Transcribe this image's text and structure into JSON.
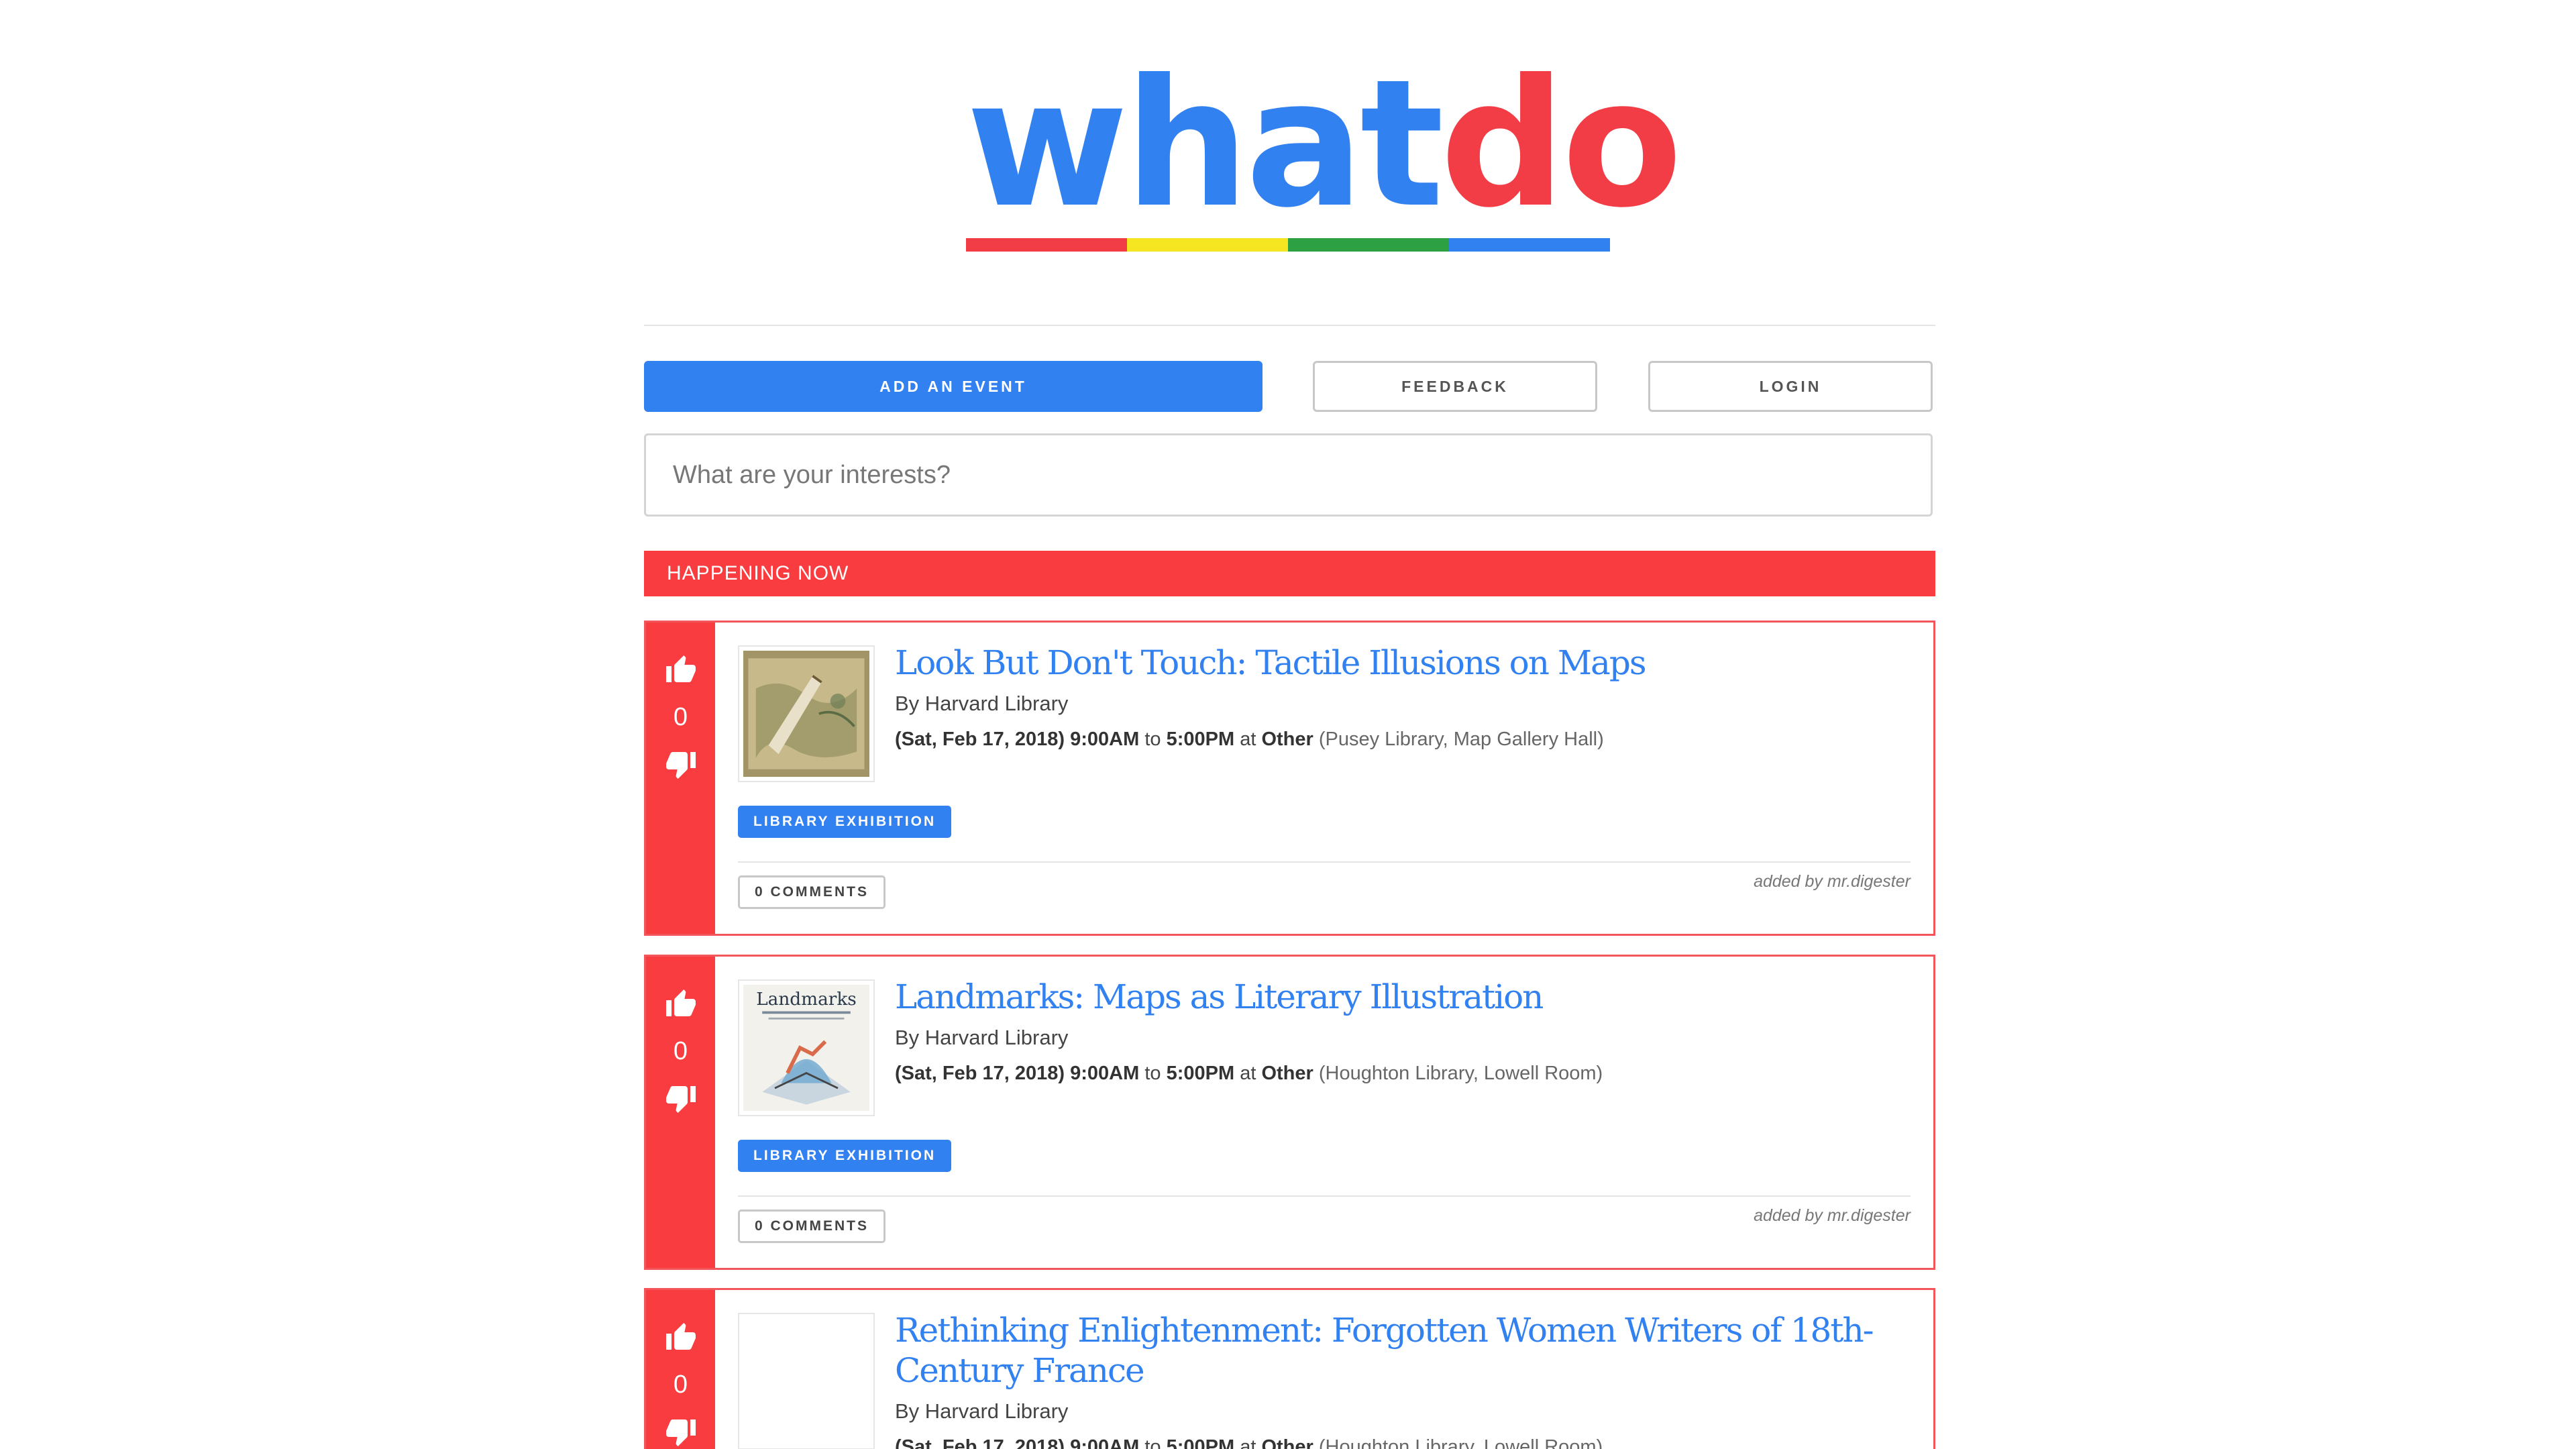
{
  "logo": {
    "part1": "what",
    "part2": "do",
    "bar_colors": [
      "#f23d46",
      "#f6e521",
      "#2da043",
      "#3281f0"
    ]
  },
  "colors": {
    "primary": "#3281f0",
    "accent_red": "#f83c3f"
  },
  "buttons": {
    "add_event": "ADD AN EVENT",
    "feedback": "FEEDBACK",
    "login": "LOGIN"
  },
  "search": {
    "placeholder": "What are your interests?",
    "value": ""
  },
  "section": {
    "label": "HAPPENING NOW"
  },
  "events": [
    {
      "title": "Look But Don't Touch: Tactile Illusions on Maps",
      "by": "By Harvard Library",
      "date": "(Sat, Feb 17, 2018) 9:00AM",
      "to": "to",
      "end": "5:00PM",
      "at": "at",
      "category": "Other",
      "location": "(Pusey Library, Map Gallery Hall)",
      "tag": "LIBRARY EXHIBITION",
      "comments": "0 COMMENTS",
      "added_by": "added by mr.digester",
      "votes": "0",
      "thumb_icon": "antique-map-thumbnail"
    },
    {
      "title": "Landmarks: Maps as Literary Illustration",
      "by": "By Harvard Library",
      "date": "(Sat, Feb 17, 2018) 9:00AM",
      "to": "to",
      "end": "5:00PM",
      "at": "at",
      "category": "Other",
      "location": "(Houghton Library, Lowell Room)",
      "tag": "LIBRARY EXHIBITION",
      "comments": "0 COMMENTS",
      "added_by": "added by mr.digester",
      "votes": "0",
      "thumb_icon": "landmarks-poster-thumbnail",
      "thumb_text": "Landmarks"
    },
    {
      "title": "Rethinking Enlightenment: Forgotten Women Writers of 18th-Century France",
      "by": "By Harvard Library",
      "date": "(Sat, Feb 17, 2018) 9:00AM",
      "to": "to",
      "end": "5:00PM",
      "at": "at",
      "category": "Other",
      "location": "(Houghton Library, Lowell Room)",
      "votes": "0",
      "thumb_icon": "blank-thumbnail"
    }
  ]
}
